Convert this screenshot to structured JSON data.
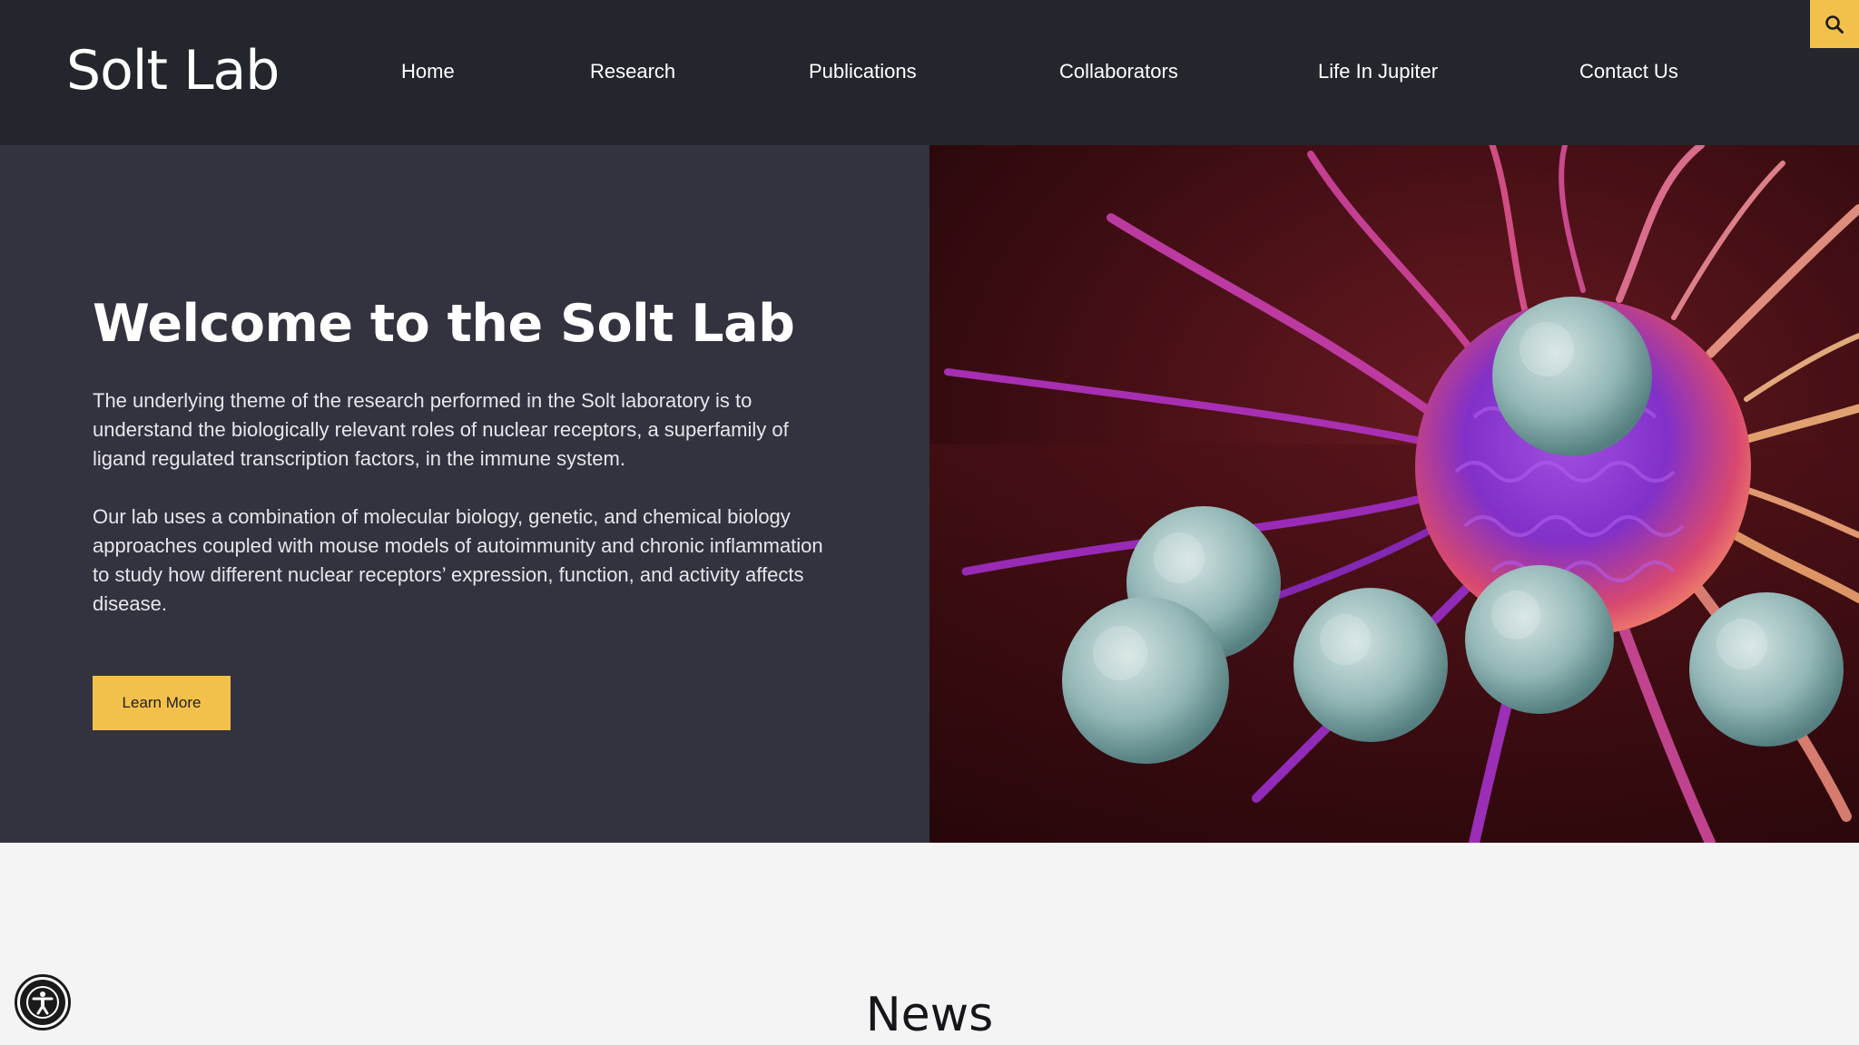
{
  "header": {
    "logo": "Solt Lab",
    "nav": [
      {
        "label": "Home"
      },
      {
        "label": "Research"
      },
      {
        "label": "Publications"
      },
      {
        "label": "Collaborators"
      },
      {
        "label": "Life In Jupiter"
      },
      {
        "label": "Contact Us"
      }
    ],
    "search_icon": "search-icon"
  },
  "hero": {
    "title": "Welcome to the Solt Lab",
    "paragraphs": [
      "The underlying theme of the research performed in the Solt laboratory is to understand the biologically relevant roles of nuclear receptors, a superfamily of ligand regulated transcription factors, in the immune system.",
      "Our lab uses a combination of molecular biology, genetic, and chemical biology approaches coupled with mouse models of autoimmunity and chronic inflammation to study how different nuclear receptors’ expression, function, and activity affects disease."
    ],
    "button_label": "Learn More",
    "image": "cancer-cell-with-t-cells-illustration"
  },
  "news": {
    "title": "News"
  },
  "accessibility": {
    "icon": "accessibility-icon"
  },
  "colors": {
    "header_bg": "#23262c",
    "hero_bg": "#32333e",
    "accent": "#f3c14b",
    "page_bg": "#f4f4f4"
  }
}
